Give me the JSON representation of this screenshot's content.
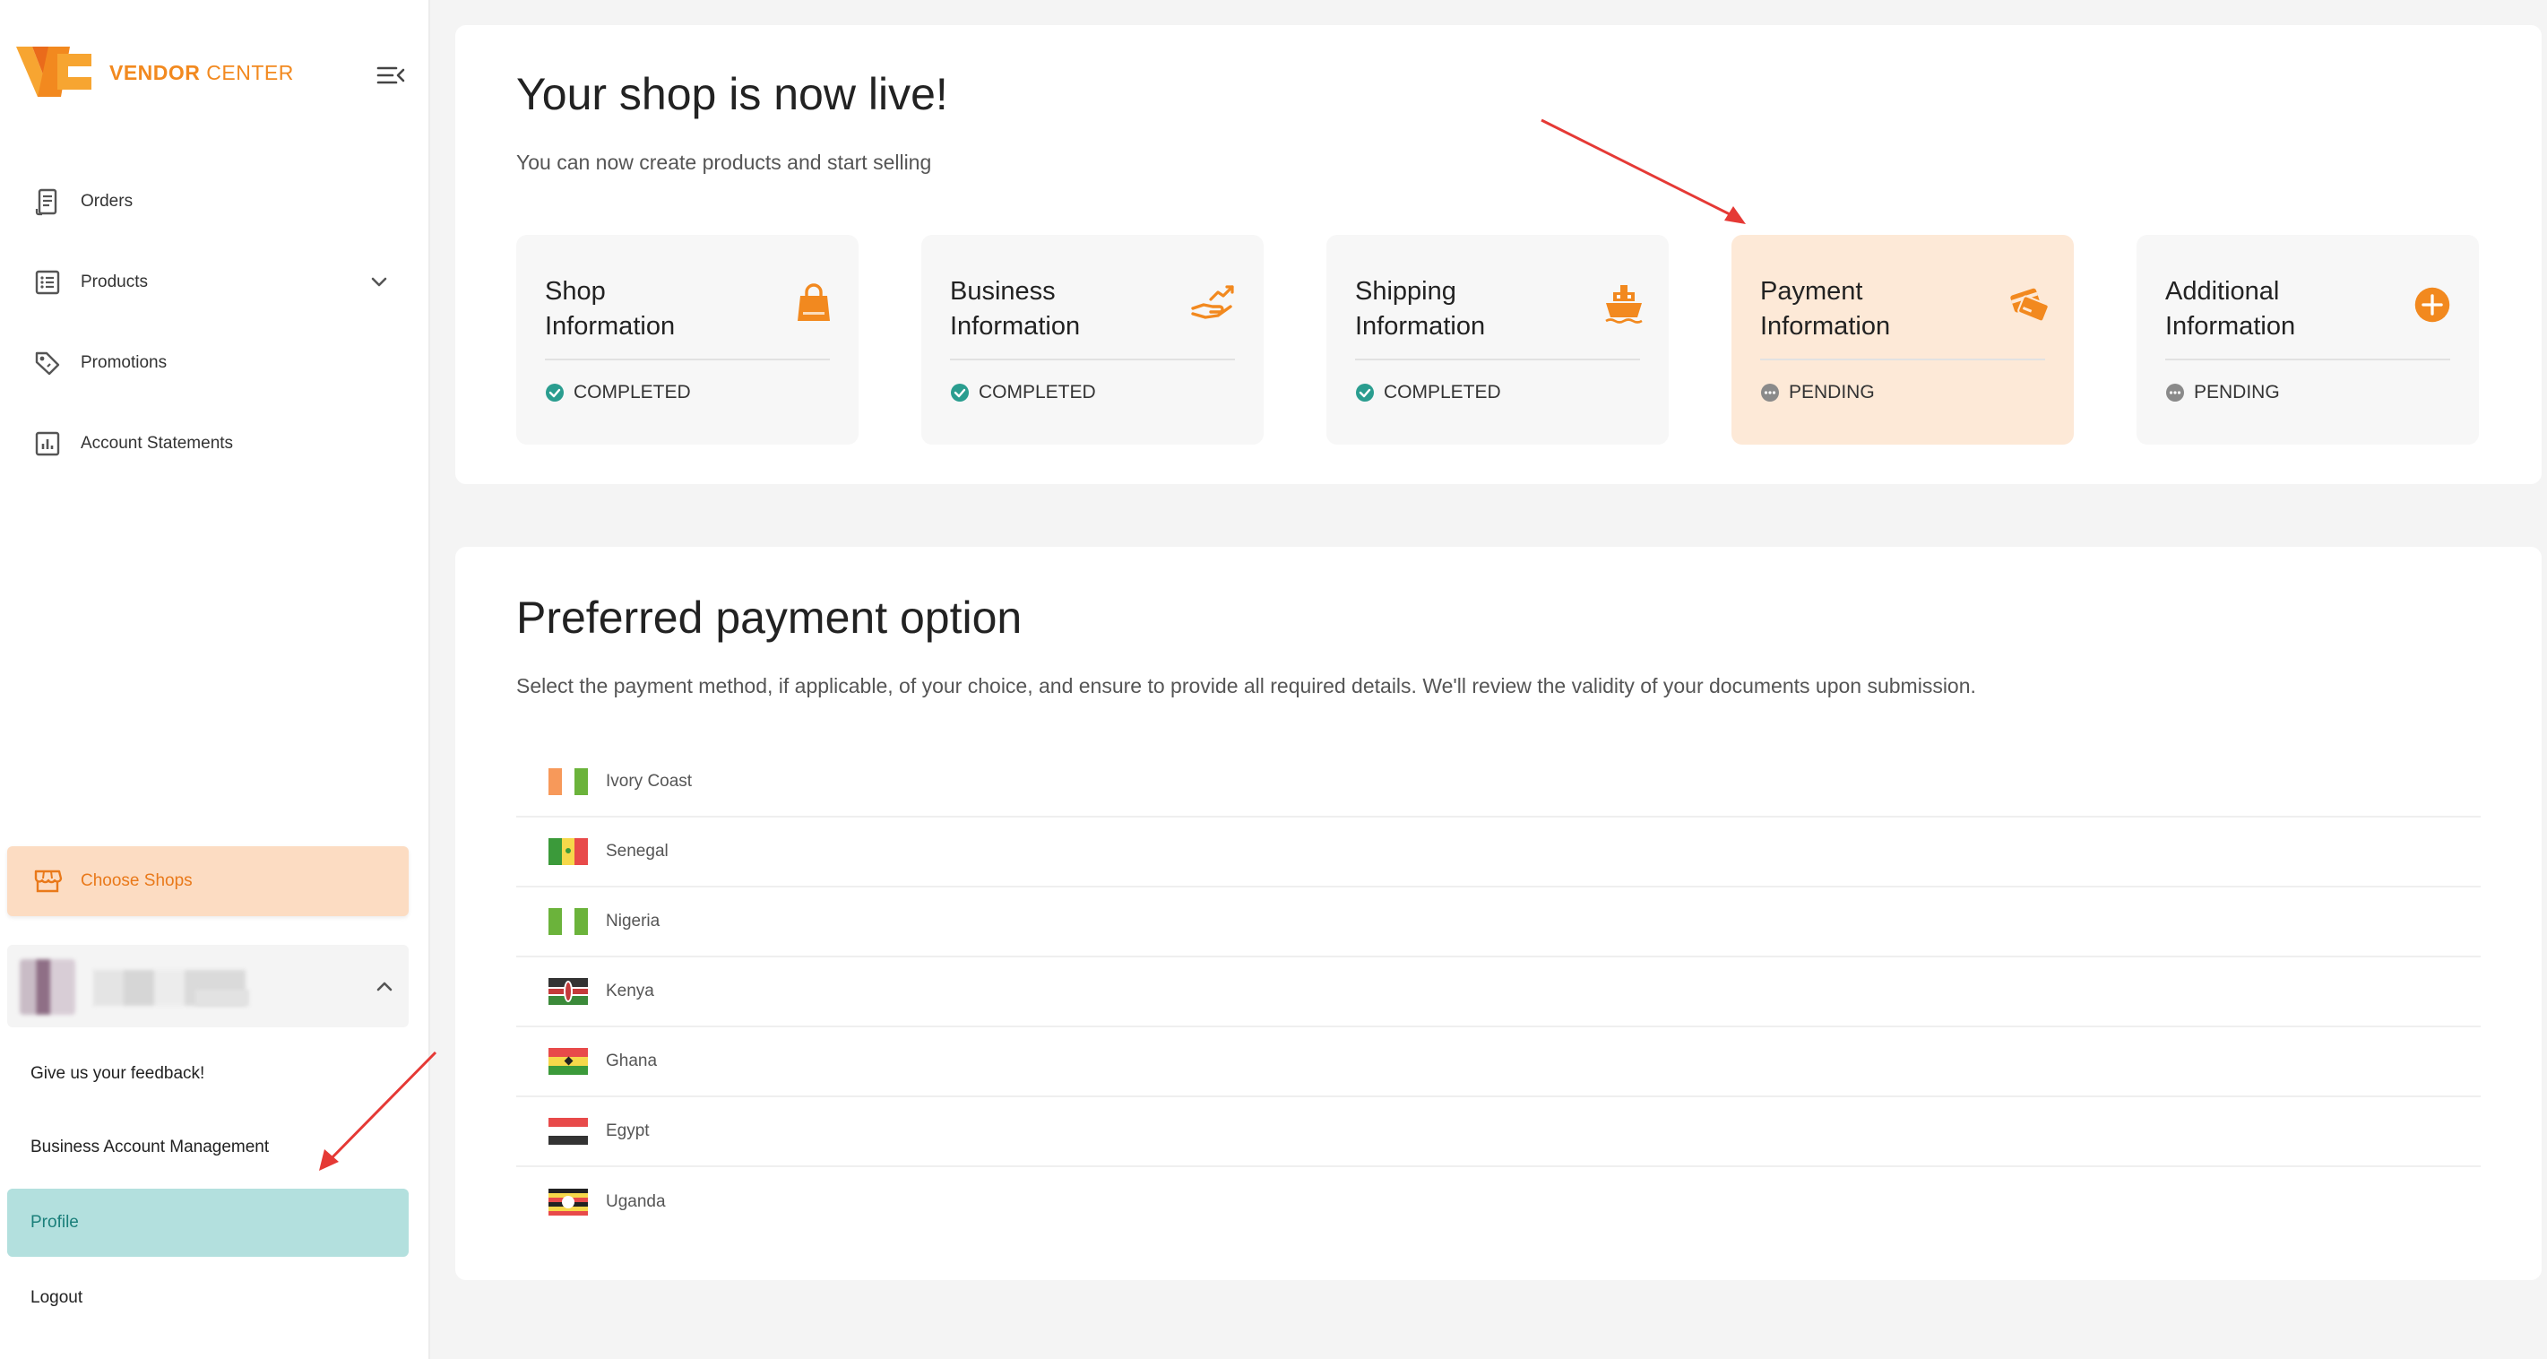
{
  "brand": {
    "logo_text_strong": "VENDOR",
    "logo_text": "CENTER",
    "accent_color": "#f2891f",
    "teal_color": "#2a9d8f"
  },
  "sidebar": {
    "collapse_icon": "menu-collapse-icon",
    "items": [
      {
        "label": "Orders",
        "icon": "receipt-icon"
      },
      {
        "label": "Products",
        "icon": "list-icon",
        "has_chevron": true
      },
      {
        "label": "Promotions",
        "icon": "tag-icon"
      },
      {
        "label": "Account Statements",
        "icon": "chart-icon"
      }
    ],
    "choose_shops": {
      "label": "Choose Shops",
      "icon": "store-icon"
    },
    "links": [
      {
        "label": "Give us your feedback!"
      },
      {
        "label": "Business Account Management"
      },
      {
        "label": "Profile",
        "active": true
      },
      {
        "label": "Logout"
      }
    ]
  },
  "live": {
    "title": "Your shop is now live!",
    "subtitle": "You can now create products and start selling",
    "steps": [
      {
        "title_line1": "Shop",
        "title_line2": "Information",
        "status": "COMPLETED",
        "icon": "shopping-bag-icon"
      },
      {
        "title_line1": "Business",
        "title_line2": "Information",
        "status": "COMPLETED",
        "icon": "growth-hand-icon"
      },
      {
        "title_line1": "Shipping",
        "title_line2": "Information",
        "status": "COMPLETED",
        "icon": "ship-icon"
      },
      {
        "title_line1": "Payment",
        "title_line2": "Information",
        "status": "PENDING",
        "icon": "payment-cards-icon",
        "highlight": true
      },
      {
        "title_line1": "Additional",
        "title_line2": "Information",
        "status": "PENDING",
        "icon": "plus-circle-icon"
      }
    ]
  },
  "payment": {
    "title": "Preferred payment option",
    "description": "Select the payment method, if applicable, of your choice, and ensure to provide all required details. We'll review the validity of your documents upon submission.",
    "countries": [
      {
        "name": "Ivory Coast"
      },
      {
        "name": "Senegal"
      },
      {
        "name": "Nigeria"
      },
      {
        "name": "Kenya"
      },
      {
        "name": "Ghana"
      },
      {
        "name": "Egypt"
      },
      {
        "name": "Uganda"
      }
    ]
  }
}
